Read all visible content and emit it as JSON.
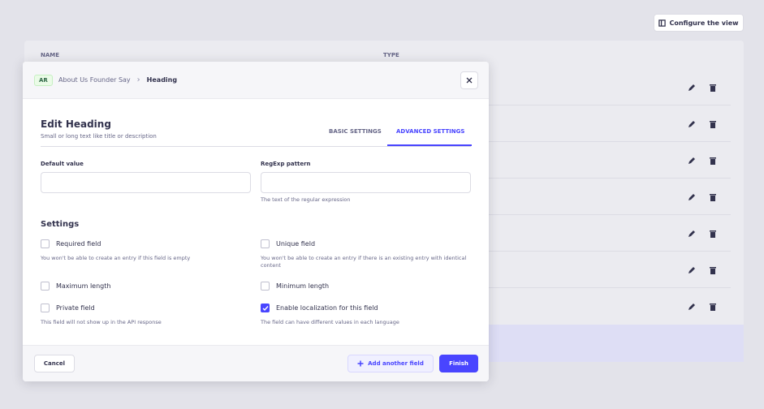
{
  "background": {
    "configure_button": {
      "label": "Configure the view",
      "icon": "layout-icon"
    },
    "table": {
      "headers": [
        "NAME",
        "TYPE"
      ],
      "row_actions": [
        "edit-icon",
        "delete-icon"
      ],
      "row_count": 7
    }
  },
  "modal": {
    "header": {
      "locale_badge": "AR",
      "breadcrumb": [
        "About Us Founder Say",
        "Heading"
      ],
      "close_icon": "close-icon"
    },
    "title": "Edit Heading",
    "subtitle": "Small or long text like title or description",
    "tabs": [
      {
        "label": "BASIC SETTINGS",
        "active": false
      },
      {
        "label": "ADVANCED SETTINGS",
        "active": true
      }
    ],
    "fields": {
      "default_value": {
        "label": "Default value",
        "value": ""
      },
      "regexp_pattern": {
        "label": "RegExp pattern",
        "value": "",
        "hint": "The text of the regular expression"
      }
    },
    "settings": {
      "title": "Settings",
      "options": [
        {
          "label": "Required field",
          "checked": false,
          "hint": "You won't be able to create an entry if this field is empty"
        },
        {
          "label": "Unique field",
          "checked": false,
          "hint": "You won't be able to create an entry if there is an existing entry with identical content"
        },
        {
          "label": "Maximum length",
          "checked": false,
          "hint": ""
        },
        {
          "label": "Minimum length",
          "checked": false,
          "hint": ""
        },
        {
          "label": "Private field",
          "checked": false,
          "hint": "This field will not show up in the API response"
        },
        {
          "label": "Enable localization for this field",
          "checked": true,
          "hint": "The field can have different values in each language"
        }
      ]
    },
    "footer": {
      "cancel_label": "Cancel",
      "add_field_label": "Add another field",
      "finish_label": "Finish"
    }
  },
  "colors": {
    "accent": "#4945ff",
    "overlay": "#e3e3ea",
    "badge_bg": "#eafbe7"
  }
}
